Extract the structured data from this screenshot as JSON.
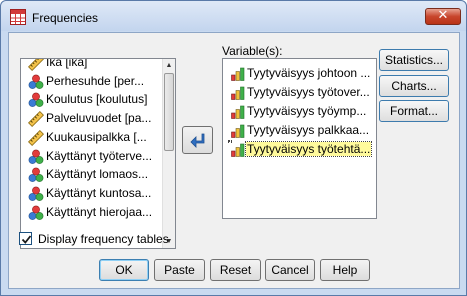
{
  "window": {
    "title": "Frequencies",
    "close_glyph": "✕"
  },
  "source_list": {
    "items": [
      {
        "label": "Ikä [ikä]",
        "icon": "ruler-icon"
      },
      {
        "label": "Perhesuhde [per...",
        "icon": "nominal-icon"
      },
      {
        "label": "Koulutus [koulutus]",
        "icon": "nominal-icon"
      },
      {
        "label": "Palveluvuodet [pa...",
        "icon": "ruler-icon"
      },
      {
        "label": "Kuukausipalkka [...",
        "icon": "ruler-icon"
      },
      {
        "label": "Käyttänyt työterve...",
        "icon": "nominal-icon"
      },
      {
        "label": "Käyttänyt lomaos...",
        "icon": "nominal-icon"
      },
      {
        "label": "Käyttänyt kuntosa...",
        "icon": "nominal-icon"
      },
      {
        "label": "Käyttänyt hierojaa...",
        "icon": "nominal-icon"
      }
    ]
  },
  "move_button": {
    "icon": "move-arrow-icon"
  },
  "target": {
    "label": "Variable(s):",
    "items": [
      {
        "label": "Tyytyväisyys johtoon ...",
        "icon": "ordinal-icon",
        "selected": false
      },
      {
        "label": "Tyytyväisyys työtover...",
        "icon": "ordinal-icon",
        "selected": false
      },
      {
        "label": "Tyytyväisyys työymp...",
        "icon": "ordinal-icon",
        "selected": false
      },
      {
        "label": "Tyytyväisyys palkkaa...",
        "icon": "ordinal-icon",
        "selected": false
      },
      {
        "label": "Tyytyväisyys työtehtä...",
        "icon": "ordinal-icon",
        "selected": true
      }
    ]
  },
  "side_buttons": {
    "statistics": "Statistics...",
    "charts": "Charts...",
    "format": "Format..."
  },
  "checkbox": {
    "label": "Display frequency tables",
    "checked": true
  },
  "buttons": {
    "ok": "OK",
    "paste": "Paste",
    "reset": "Reset",
    "cancel": "Cancel",
    "help": "Help"
  },
  "colors": {
    "accent_border": "#3c7fb1",
    "selection_bg": "#fffa9c",
    "close_red": "#c8452c"
  }
}
